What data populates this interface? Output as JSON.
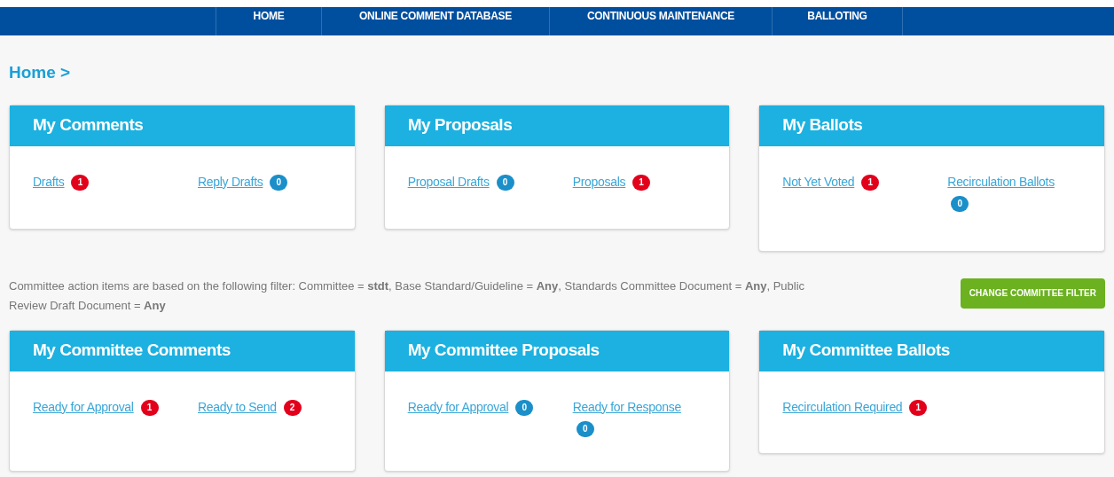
{
  "nav": [
    {
      "label": "HOME"
    },
    {
      "label": "ONLINE COMMENT DATABASE"
    },
    {
      "label": "CONTINUOUS MAINTENANCE"
    },
    {
      "label": "BALLOTING"
    }
  ],
  "breadcrumb": "Home >",
  "cards_top": [
    {
      "title": "My Comments",
      "links": [
        {
          "label": "Drafts",
          "count": "1",
          "color": "#e3001b"
        },
        {
          "label": "Reply Drafts",
          "count": "0",
          "color": "#1a8fc9"
        }
      ]
    },
    {
      "title": "My Proposals",
      "links": [
        {
          "label": "Proposal Drafts",
          "count": "0",
          "color": "#1a8fc9"
        },
        {
          "label": "Proposals",
          "count": "1",
          "color": "#e3001b"
        }
      ]
    },
    {
      "title": "My Ballots",
      "links": [
        {
          "label": "Not Yet Voted",
          "count": "1",
          "color": "#e3001b"
        },
        {
          "label": "Recirculation Ballots",
          "count": "0",
          "color": "#1a8fc9"
        }
      ]
    }
  ],
  "filter_text": "Committee action items are based on the following filter: Committee = **stdt**, Base Standard/Guideline = **Any**, Standards Committee Document = **Any**, Public Review Draft Document = **Any**",
  "filter_button": "CHANGE COMMITTEE FILTER",
  "cards_bottom": [
    {
      "title": "My Committee Comments",
      "links": [
        {
          "label": "Ready for Approval",
          "count": "1",
          "color": "#e3001b"
        },
        {
          "label": "Ready to Send",
          "count": "2",
          "color": "#e3001b"
        }
      ]
    },
    {
      "title": "My Committee Proposals",
      "links": [
        {
          "label": "Ready for Approval",
          "count": "0",
          "color": "#1a8fc9"
        },
        {
          "label": "Ready for Response",
          "count": "0",
          "color": "#1a8fc9"
        }
      ]
    },
    {
      "title": "My Committee Ballots",
      "links": [
        {
          "label": "Recirculation Required",
          "count": "1",
          "color": "#e3001b"
        }
      ]
    }
  ]
}
